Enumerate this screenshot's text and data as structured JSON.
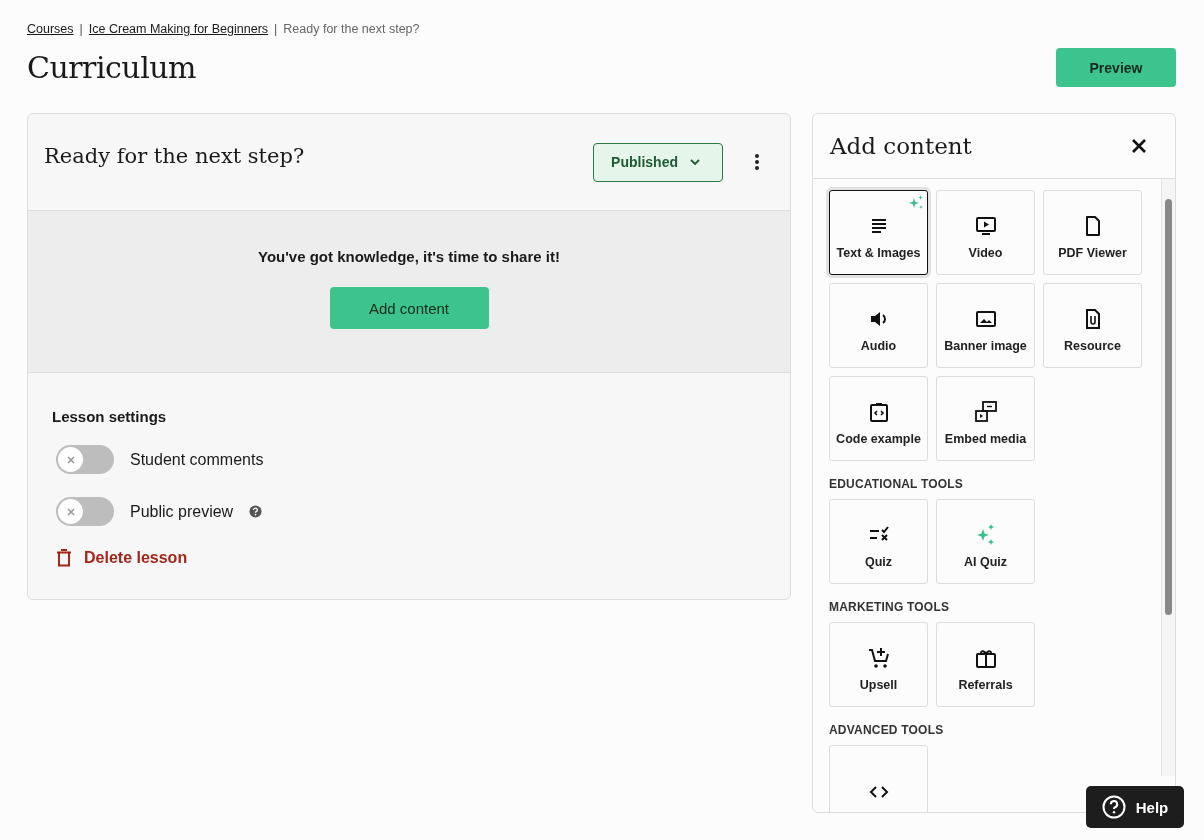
{
  "breadcrumb": [
    {
      "label": "Courses",
      "link": true
    },
    {
      "separator": "|",
      "label": "Ice Cream Making for Beginners",
      "link": true
    },
    {
      "separator": "|",
      "label": "Ready for the next step?",
      "link": false
    }
  ],
  "page_title": "Curriculum",
  "preview_button": "Preview",
  "lesson": {
    "title": "Ready for the next step?",
    "status": "Published",
    "empty_message": "You've got knowledge, it's time to share it!",
    "add_button": "Add content",
    "settings_title": "Lesson settings",
    "settings": [
      {
        "label": "Student comments",
        "on": false,
        "help": false
      },
      {
        "label": "Public preview",
        "on": false,
        "help": true
      }
    ],
    "delete": "Delete lesson"
  },
  "panel": {
    "title": "Add content",
    "sections": [
      {
        "tiles": [
          {
            "kind": "text",
            "label": "Text & Images",
            "selected": true,
            "ai": true
          },
          {
            "kind": "video",
            "label": "Video",
            "selected": false,
            "ai": false
          },
          {
            "kind": "pdf",
            "label": "PDF Viewer",
            "selected": false,
            "ai": false
          },
          {
            "kind": "audio",
            "label": "Audio",
            "selected": false,
            "ai": false
          },
          {
            "kind": "image",
            "label": "Banner image",
            "selected": false,
            "ai": false
          },
          {
            "kind": "resource",
            "label": "Resource",
            "selected": false,
            "ai": false
          },
          {
            "kind": "code",
            "label": "Code example",
            "selected": false,
            "ai": false
          },
          {
            "kind": "embed",
            "label": "Embed media",
            "selected": false,
            "ai": false
          }
        ]
      },
      {
        "heading": "EDUCATIONAL TOOLS",
        "tiles": [
          {
            "kind": "quiz",
            "label": "Quiz",
            "selected": false,
            "ai": false
          },
          {
            "kind": "sparkle",
            "label": "AI Quiz",
            "selected": false,
            "ai": false
          }
        ]
      },
      {
        "heading": "MARKETING TOOLS",
        "tiles": [
          {
            "kind": "cart",
            "label": "Upsell",
            "selected": false,
            "ai": false
          },
          {
            "kind": "gift",
            "label": "Referrals",
            "selected": false,
            "ai": false
          }
        ]
      },
      {
        "heading": "ADVANCED TOOLS",
        "tiles": [
          {
            "kind": "brackets",
            "selected": false,
            "ai": false
          }
        ]
      }
    ]
  },
  "help_button": "Help"
}
